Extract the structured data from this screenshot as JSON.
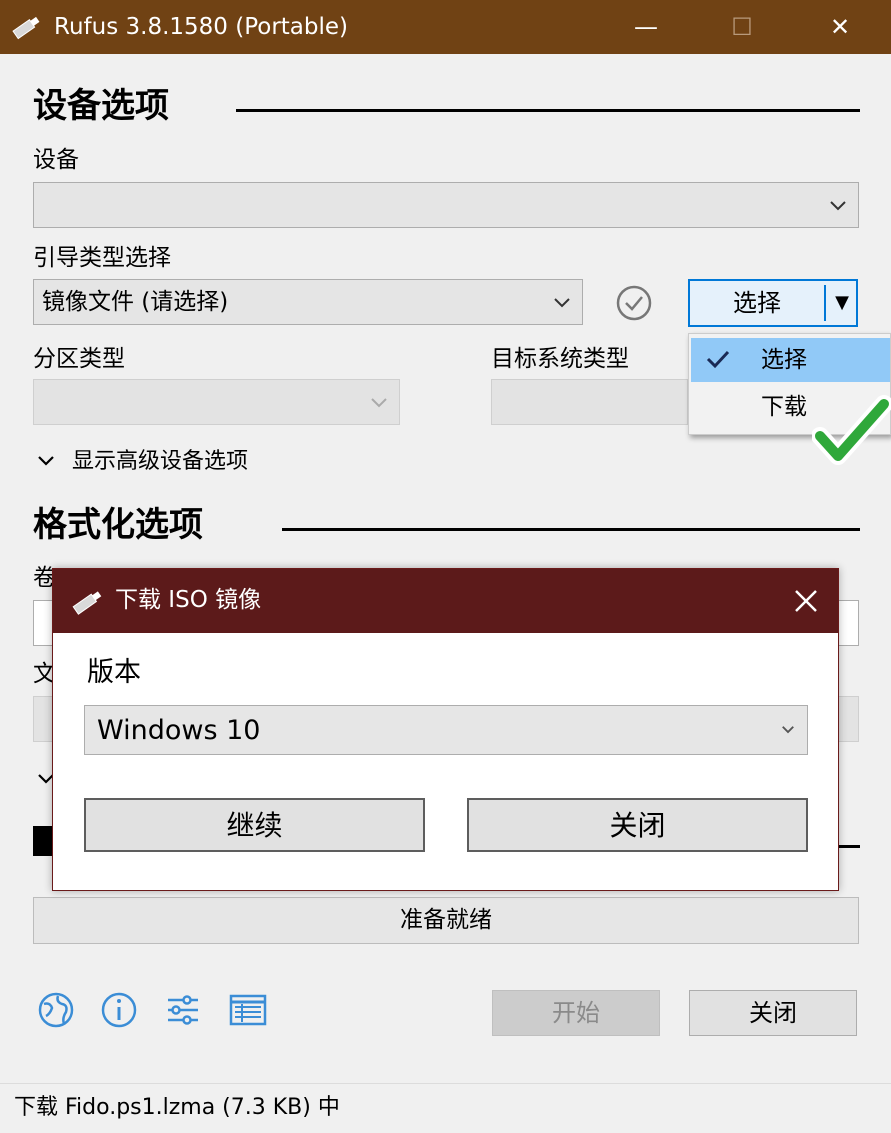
{
  "window": {
    "title": "Rufus 3.8.1580 (Portable)",
    "minimize_glyph": "—",
    "maximize_glyph": "☐",
    "close_glyph": "✕",
    "titlebar_color": "#704214"
  },
  "device_section": {
    "title": "设备选项",
    "device_label": "设备",
    "device_value": "",
    "boot_label": "引导类型选择",
    "boot_value": "镜像文件 (请选择)",
    "select_button": "选择",
    "select_dropdown_glyph": "▼",
    "partition_label": "分区类型",
    "target_label": "目标系统类型",
    "advanced_toggle": "显示高级设备选项"
  },
  "select_menu": {
    "items": [
      {
        "label": "选择",
        "checked": true
      },
      {
        "label": "下载",
        "checked": false
      }
    ],
    "highlight_color": "#91c9f7"
  },
  "format_section": {
    "title": "格式化选项",
    "volume_label_partial": "卷",
    "filesystem_label_partial": "文"
  },
  "download_dialog": {
    "title": "下载 ISO 镜像",
    "version_label": "版本",
    "version_value": "Windows 10",
    "continue_button": "继续",
    "close_button": "关闭",
    "titlebar_color": "#5c1a1a"
  },
  "status_section": {
    "progress_text": "准备就绪"
  },
  "bottom": {
    "icons": [
      "globe-icon",
      "info-icon",
      "settings-icon",
      "log-icon"
    ],
    "start_button": "开始",
    "close_button": "关闭"
  },
  "status_bar": {
    "text": "下载 Fido.ps1.lzma (7.3 KB) 中"
  },
  "accent_check_color": "#2fa83a"
}
